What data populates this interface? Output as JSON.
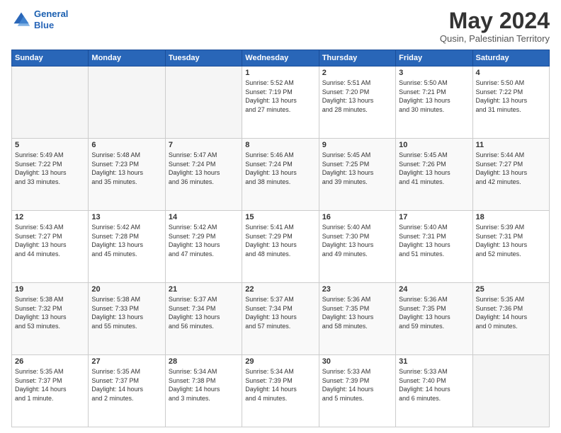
{
  "header": {
    "logo_line1": "General",
    "logo_line2": "Blue",
    "month_title": "May 2024",
    "location": "Qusin, Palestinian Territory"
  },
  "weekdays": [
    "Sunday",
    "Monday",
    "Tuesday",
    "Wednesday",
    "Thursday",
    "Friday",
    "Saturday"
  ],
  "weeks": [
    [
      {
        "day": "",
        "info": ""
      },
      {
        "day": "",
        "info": ""
      },
      {
        "day": "",
        "info": ""
      },
      {
        "day": "1",
        "info": "Sunrise: 5:52 AM\nSunset: 7:19 PM\nDaylight: 13 hours\nand 27 minutes."
      },
      {
        "day": "2",
        "info": "Sunrise: 5:51 AM\nSunset: 7:20 PM\nDaylight: 13 hours\nand 28 minutes."
      },
      {
        "day": "3",
        "info": "Sunrise: 5:50 AM\nSunset: 7:21 PM\nDaylight: 13 hours\nand 30 minutes."
      },
      {
        "day": "4",
        "info": "Sunrise: 5:50 AM\nSunset: 7:22 PM\nDaylight: 13 hours\nand 31 minutes."
      }
    ],
    [
      {
        "day": "5",
        "info": "Sunrise: 5:49 AM\nSunset: 7:22 PM\nDaylight: 13 hours\nand 33 minutes."
      },
      {
        "day": "6",
        "info": "Sunrise: 5:48 AM\nSunset: 7:23 PM\nDaylight: 13 hours\nand 35 minutes."
      },
      {
        "day": "7",
        "info": "Sunrise: 5:47 AM\nSunset: 7:24 PM\nDaylight: 13 hours\nand 36 minutes."
      },
      {
        "day": "8",
        "info": "Sunrise: 5:46 AM\nSunset: 7:24 PM\nDaylight: 13 hours\nand 38 minutes."
      },
      {
        "day": "9",
        "info": "Sunrise: 5:45 AM\nSunset: 7:25 PM\nDaylight: 13 hours\nand 39 minutes."
      },
      {
        "day": "10",
        "info": "Sunrise: 5:45 AM\nSunset: 7:26 PM\nDaylight: 13 hours\nand 41 minutes."
      },
      {
        "day": "11",
        "info": "Sunrise: 5:44 AM\nSunset: 7:27 PM\nDaylight: 13 hours\nand 42 minutes."
      }
    ],
    [
      {
        "day": "12",
        "info": "Sunrise: 5:43 AM\nSunset: 7:27 PM\nDaylight: 13 hours\nand 44 minutes."
      },
      {
        "day": "13",
        "info": "Sunrise: 5:42 AM\nSunset: 7:28 PM\nDaylight: 13 hours\nand 45 minutes."
      },
      {
        "day": "14",
        "info": "Sunrise: 5:42 AM\nSunset: 7:29 PM\nDaylight: 13 hours\nand 47 minutes."
      },
      {
        "day": "15",
        "info": "Sunrise: 5:41 AM\nSunset: 7:29 PM\nDaylight: 13 hours\nand 48 minutes."
      },
      {
        "day": "16",
        "info": "Sunrise: 5:40 AM\nSunset: 7:30 PM\nDaylight: 13 hours\nand 49 minutes."
      },
      {
        "day": "17",
        "info": "Sunrise: 5:40 AM\nSunset: 7:31 PM\nDaylight: 13 hours\nand 51 minutes."
      },
      {
        "day": "18",
        "info": "Sunrise: 5:39 AM\nSunset: 7:31 PM\nDaylight: 13 hours\nand 52 minutes."
      }
    ],
    [
      {
        "day": "19",
        "info": "Sunrise: 5:38 AM\nSunset: 7:32 PM\nDaylight: 13 hours\nand 53 minutes."
      },
      {
        "day": "20",
        "info": "Sunrise: 5:38 AM\nSunset: 7:33 PM\nDaylight: 13 hours\nand 55 minutes."
      },
      {
        "day": "21",
        "info": "Sunrise: 5:37 AM\nSunset: 7:34 PM\nDaylight: 13 hours\nand 56 minutes."
      },
      {
        "day": "22",
        "info": "Sunrise: 5:37 AM\nSunset: 7:34 PM\nDaylight: 13 hours\nand 57 minutes."
      },
      {
        "day": "23",
        "info": "Sunrise: 5:36 AM\nSunset: 7:35 PM\nDaylight: 13 hours\nand 58 minutes."
      },
      {
        "day": "24",
        "info": "Sunrise: 5:36 AM\nSunset: 7:35 PM\nDaylight: 13 hours\nand 59 minutes."
      },
      {
        "day": "25",
        "info": "Sunrise: 5:35 AM\nSunset: 7:36 PM\nDaylight: 14 hours\nand 0 minutes."
      }
    ],
    [
      {
        "day": "26",
        "info": "Sunrise: 5:35 AM\nSunset: 7:37 PM\nDaylight: 14 hours\nand 1 minute."
      },
      {
        "day": "27",
        "info": "Sunrise: 5:35 AM\nSunset: 7:37 PM\nDaylight: 14 hours\nand 2 minutes."
      },
      {
        "day": "28",
        "info": "Sunrise: 5:34 AM\nSunset: 7:38 PM\nDaylight: 14 hours\nand 3 minutes."
      },
      {
        "day": "29",
        "info": "Sunrise: 5:34 AM\nSunset: 7:39 PM\nDaylight: 14 hours\nand 4 minutes."
      },
      {
        "day": "30",
        "info": "Sunrise: 5:33 AM\nSunset: 7:39 PM\nDaylight: 14 hours\nand 5 minutes."
      },
      {
        "day": "31",
        "info": "Sunrise: 5:33 AM\nSunset: 7:40 PM\nDaylight: 14 hours\nand 6 minutes."
      },
      {
        "day": "",
        "info": ""
      }
    ]
  ]
}
